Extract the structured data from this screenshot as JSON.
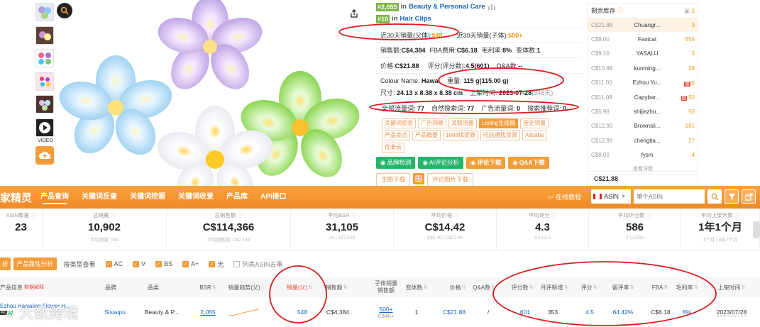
{
  "thumbs": {
    "video_label": "VIDEO"
  },
  "info": {
    "rank1_num": "#2,055",
    "rank1_in": "in",
    "rank1_cat": "Beauty & Personal Care",
    "rank2_num": "#10",
    "rank2_in": "in",
    "rank2_cat": "Hair Clips",
    "parent_sales_label": "近30天销量(父体):",
    "parent_sales_value": "548",
    "child_sales_label": "近30天销量(子体):",
    "child_sales_value": "500+",
    "revenue_label": "销售额:",
    "revenue_value": "C$4,384",
    "fba_label": "FBA费用:",
    "fba_value": "C$6.18",
    "margin_label": "毛利率:",
    "margin_value": "8%",
    "variants_label": "变体数:",
    "variants_value": "1",
    "price_label": "价格:",
    "price_value": "C$21.88",
    "rating_label": "评分(评分数):",
    "rating_value": "4.5(601)",
    "qa_label": "Q&A数:",
    "qa_value": "--",
    "colour_label": "Colour Name:",
    "colour_value": "Hawai",
    "weight_label": "重量:",
    "weight_value": "115 g(115.00 g)",
    "size_label": "尺寸:",
    "size_value": "24.13 x 8.38 x 8.38 cm",
    "launch_label": "上架时间:",
    "launch_value": "2023-07-28",
    "launch_age": "(348天)",
    "kw_all_label": "全部流量词:",
    "kw_all_value": "77",
    "kw_nat_label": "自然搜索词:",
    "kw_nat_value": "77",
    "kw_ad_label": "广告流量词:",
    "kw_ad_value": "0",
    "kw_rec_label": "搜索推荐词:",
    "kw_rec_value": "0"
  },
  "tags": [
    "关键词反查",
    "广告洞察",
    "关联流量",
    "Listing生成器",
    "历史销量",
    "产品卖点",
    "产品概要",
    "1688找货源",
    "旺店通找货源",
    "Alibaba",
    "优麦云"
  ],
  "buttons": {
    "brand": "品牌检测",
    "ai": "AI评论分析",
    "review_dl": "评论下载",
    "qa_dl": "Q&A下载",
    "main_img": "主图下载",
    "review_img": "评论图片下载"
  },
  "sellers": {
    "header": "剩余库存",
    "header_count": "3",
    "rows": [
      {
        "price": "C$21.88",
        "name": "Chuangr...",
        "qty": "3",
        "badge": ""
      },
      {
        "price": "C$8.00",
        "name": "Fastcat",
        "qty": "856",
        "badge": ""
      },
      {
        "price": "C$9.10",
        "name": "YASALU",
        "qty": "3",
        "badge": ""
      },
      {
        "price": "C$10.99",
        "name": "kunming...",
        "qty": "28",
        "badge": ""
      },
      {
        "price": "C$11.00",
        "name": "Ezhou Yu...",
        "qty": "5",
        "badge": "限"
      },
      {
        "price": "C$11.08",
        "name": "Capybar...",
        "qty": "50",
        "badge": "限"
      },
      {
        "price": "C$5.98",
        "name": "shijiazhu...",
        "qty": "50",
        "badge": ""
      },
      {
        "price": "C$12.90",
        "name": "Brownsli...",
        "qty": "181",
        "badge": ""
      },
      {
        "price": "C$12.99",
        "name": "chengtia...",
        "qty": "27",
        "badge": ""
      },
      {
        "price": "C$8.00",
        "name": "fysm",
        "qty": "4",
        "badge": ""
      }
    ],
    "more": "查看详情"
  },
  "nav": {
    "brand": "家精灵",
    "tabs": [
      "产品查询",
      "关键词反查",
      "关键词挖掘",
      "关键词收录",
      "产品库",
      "API接口"
    ],
    "tutorial": "在线教程",
    "asin_select": "ASIN",
    "search_placeholder": "单个ASIN"
  },
  "stats": [
    {
      "label": "ASIN数量",
      "value": "23",
      "sub": ""
    },
    {
      "label": "总销量",
      "value": "10,902",
      "sub": "平均销量: 545"
    },
    {
      "label": "总销售额",
      "value": "C$114,366",
      "sub": "平均销售额: C$7,148"
    },
    {
      "label": "平均BSR",
      "value": "31,105",
      "sub": "42 | 137,028"
    },
    {
      "label": "平均价格",
      "value": "C$14.42",
      "sub": "C$3.49 | C$27.00"
    },
    {
      "label": "平均评分",
      "value": "4.3",
      "sub": "3.5 | 5.0"
    },
    {
      "label": "平均评分数",
      "value": "586",
      "sub": "2 | 3,999"
    },
    {
      "label": "平均上架天数",
      "value": "1年1个月",
      "sub": "1个月 | 8年7个月"
    }
  ],
  "filter": {
    "btn1": "析",
    "btn2": "产品属性分析",
    "view_label": "按类型查看",
    "checks": [
      "AC",
      "V",
      "BS",
      "A+",
      "无"
    ],
    "dedupe": "列表ASIN去重"
  },
  "table": {
    "headers": {
      "product": "产品信息",
      "product_link": "数据解释",
      "brand": "品牌",
      "category": "品类",
      "bsr": "BSR",
      "trend": "销量趋势(父)",
      "sales": "销量(父)",
      "revenue": "销售额",
      "child_sales_1": "子体销量",
      "child_sales_2": "销售额",
      "variants": "变体数",
      "price": "价格",
      "qa": "Q&A数",
      "ratings": "评分数",
      "monthly_new": "月评新增",
      "rating": "评分",
      "retention": "留评率",
      "fba": "FBA",
      "margin": "毛利率",
      "launch": "上架时间"
    },
    "row": {
      "title": "Ezhou Hawaiian Flower H...",
      "brand": "Sisiaipu",
      "category": "Beauty & P...",
      "bsr": "2,055",
      "sales": "548",
      "revenue": "C$4,384",
      "child_sales": "500+",
      "child_revenue": "C$4K+",
      "variants": "1",
      "price": "C$21.88",
      "qa": "/",
      "ratings": "601",
      "monthly_new": "353",
      "rating": "4.5",
      "retention": "64.42%",
      "fba": "C$6.18",
      "margin": "8%",
      "launch": "2023/07/28"
    }
  },
  "watermark": "大数跨境"
}
